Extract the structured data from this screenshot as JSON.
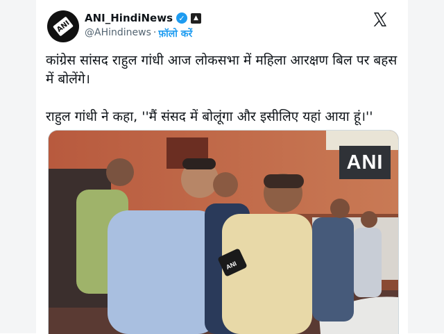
{
  "account": {
    "display_name": "ANI_HindiNews",
    "handle": "@AHindinews",
    "separator": "·",
    "follow_label": "फ़ॉलो करें",
    "avatar_text": "ANI",
    "verified_icon": "verified-badge-icon",
    "affiliation_icon": "affiliation-badge-icon"
  },
  "platform": {
    "logo": "x-logo-icon"
  },
  "tweet": {
    "line1": "कांग्रेस सांसद राहुल गांधी आज लोकसभा में महिला आरक्षण बिल पर बहस में बोलेंगे।",
    "line2": "राहुल गांधी ने कहा, ''मैं संसद में बोलूंगा और इसीलिए यहां आया हूं।''"
  },
  "media": {
    "watermark": "ANI",
    "mic_label": "ANI"
  },
  "colors": {
    "link": "#1d9bf0",
    "verified": "#1d9bf0",
    "text": "#0f1419",
    "secondary": "#536471",
    "page_side": "#f4f5f6"
  }
}
